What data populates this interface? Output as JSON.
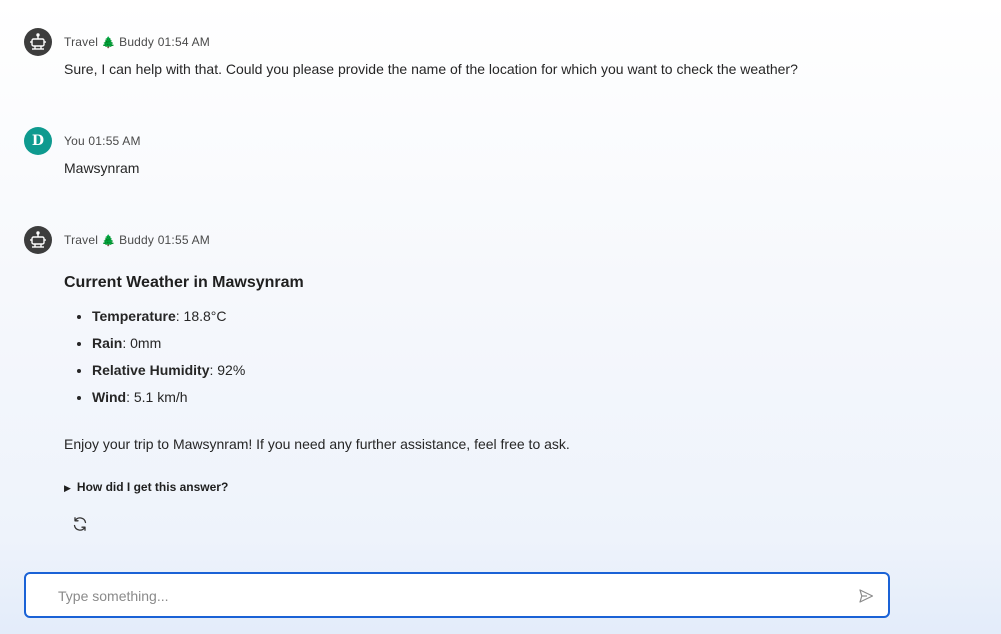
{
  "messages": [
    {
      "sender_prefix": "Travel",
      "sender_tree": "🌲",
      "sender_suffix": "Buddy",
      "time": "01:54 AM",
      "avatar_icon": "robot-icon",
      "text": "Sure, I can help with that. Could you please provide the name of the location for which you want to check the weather?"
    },
    {
      "sender": "You",
      "time": "01:55 AM",
      "avatar_letter": "D",
      "text": "Mawsynram"
    },
    {
      "sender_prefix": "Travel",
      "sender_tree": "🌲",
      "sender_suffix": "Buddy",
      "time": "01:55 AM",
      "avatar_icon": "robot-icon",
      "heading": "Current Weather in Mawsynram",
      "items": [
        {
          "label": "Temperature",
          "value": ": 18.8°C"
        },
        {
          "label": "Rain",
          "value": ": 0mm"
        },
        {
          "label": "Relative Humidity",
          "value": ": 92%"
        },
        {
          "label": "Wind",
          "value": ": 5.1 km/h"
        }
      ],
      "closing": "Enjoy your trip to Mawsynram! If you need any further assistance, feel free to ask.",
      "details_toggle": "How did I get this answer?",
      "details_icon": "triangle-right-icon",
      "regenerate_icon": "refresh-icon"
    }
  ],
  "composer": {
    "placeholder": "Type something...",
    "value": "",
    "send_icon": "send-icon"
  },
  "colors": {
    "bot_avatar": "#3d3d3d",
    "user_avatar": "#0e9a8f",
    "input_border": "#1a62d6"
  }
}
